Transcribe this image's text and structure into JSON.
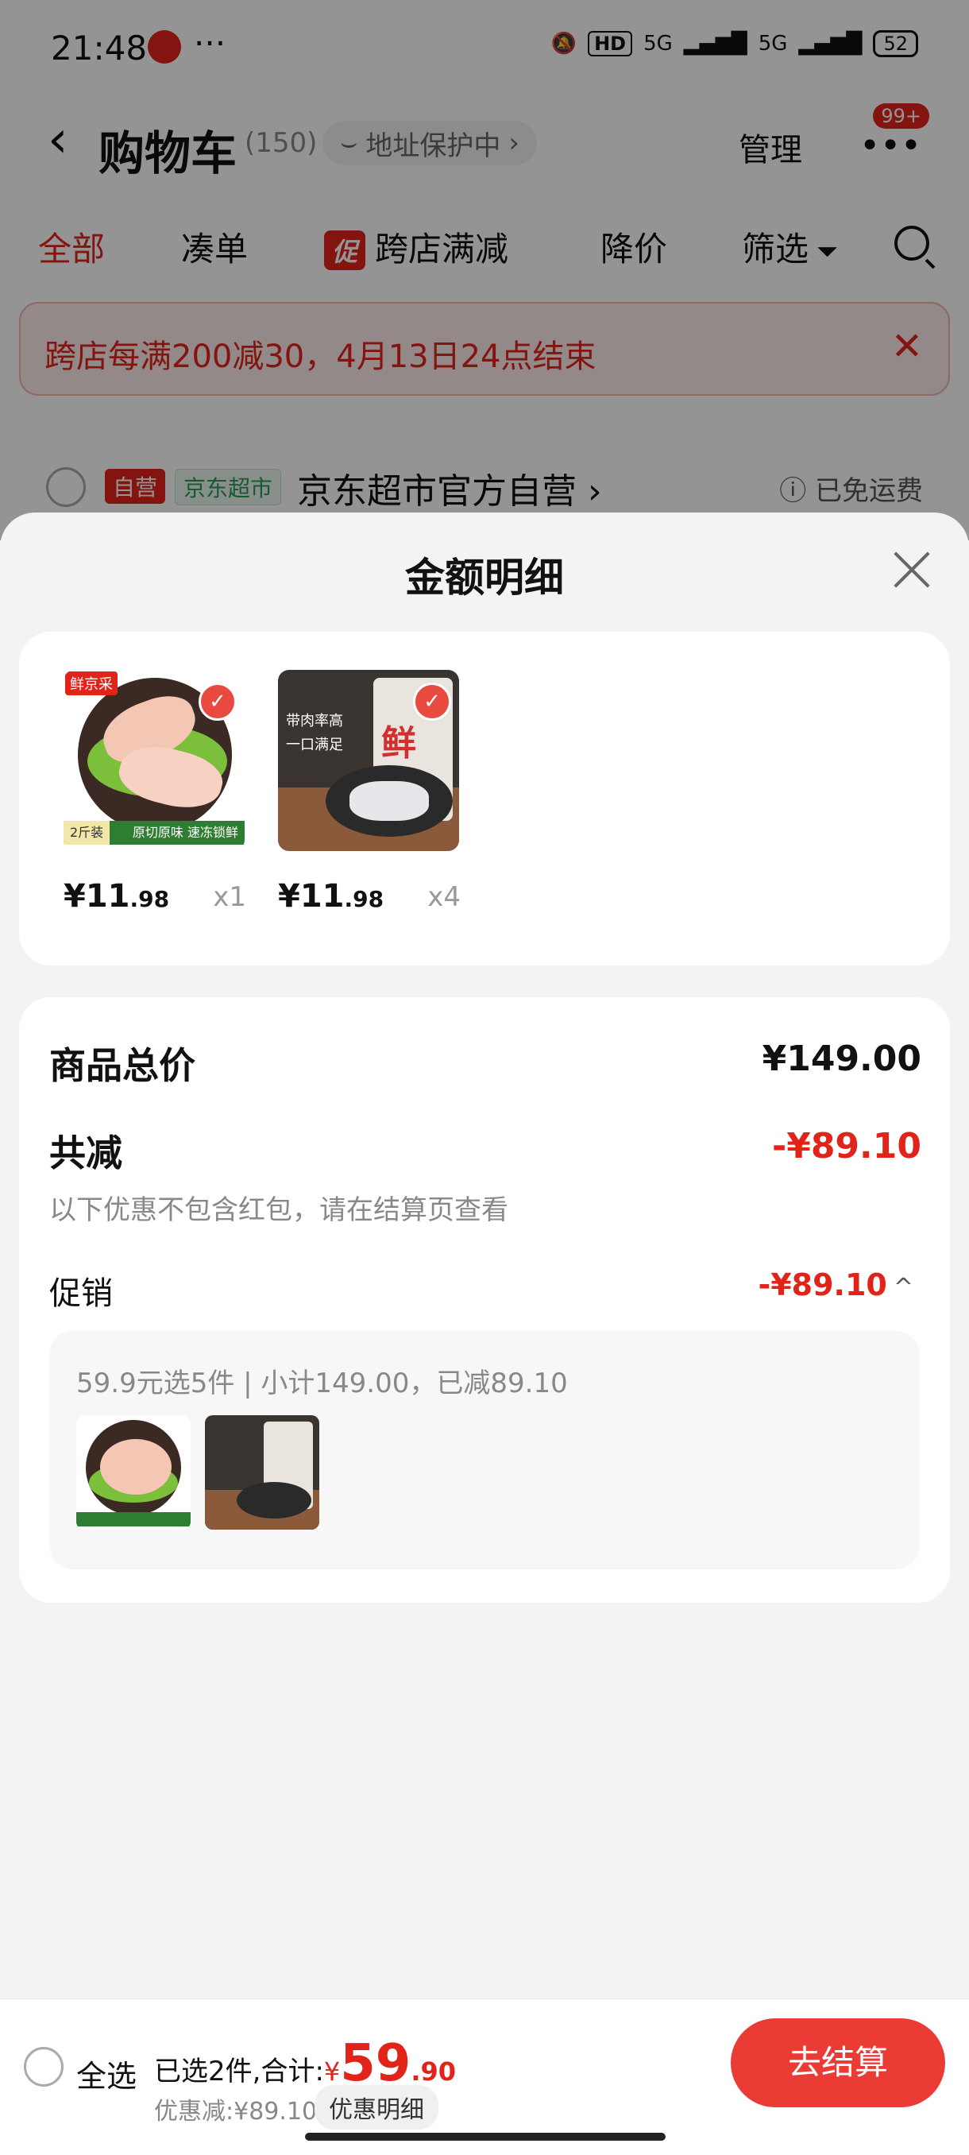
{
  "status_bar": {
    "time": "21:48",
    "dots": "···",
    "hd": "HD",
    "net1": "5G",
    "net2": "5G",
    "battery": "52"
  },
  "nav": {
    "title": "购物车",
    "count": "(150)",
    "addr": "地址保护中",
    "manage": "管理",
    "badge": "99+"
  },
  "tabs": [
    "全部",
    "凑单",
    "跨店满减",
    "降价",
    "筛选"
  ],
  "tab_promo_tag": "促",
  "promo_banner": "跨店每满200减30，4月13日24点结束",
  "store": {
    "tag_self": "自营",
    "tag_market": "京东超市",
    "name": "京东超市官方自营",
    "shipping": "已免运费"
  },
  "sheet": {
    "title": "金额明细",
    "products": [
      {
        "price_int": "¥11",
        "price_dec": ".98",
        "qty": "x1",
        "brand": "鲜京采",
        "tag1": "2斤装",
        "tag2": "原切原味 速冻锁鲜"
      },
      {
        "price_int": "¥11",
        "price_dec": ".98",
        "qty": "x4",
        "bag_label": "鲜",
        "text1": "带肉率高",
        "text2": "一口满足"
      }
    ],
    "summary": {
      "total_label": "商品总价",
      "total_value": "¥149.00",
      "reduce_label": "共减",
      "reduce_value": "-¥89.10",
      "note": "以下优惠不包含红包，请在结算页查看",
      "promo_label": "促销",
      "promo_value": "-¥89.10",
      "promo_detail": "59.9元选5件 | 小计149.00，已减89.10"
    }
  },
  "bottom": {
    "select_all": "全选",
    "selected": "已选2件,合计:",
    "yen": "¥",
    "total_int": "59",
    "total_dec": ".90",
    "discount": "优惠减:¥89.10",
    "detail_btn": "优惠明细",
    "checkout": "去结算"
  },
  "colors": {
    "accent": "#e2231a",
    "checkout": "#eb3b35"
  }
}
